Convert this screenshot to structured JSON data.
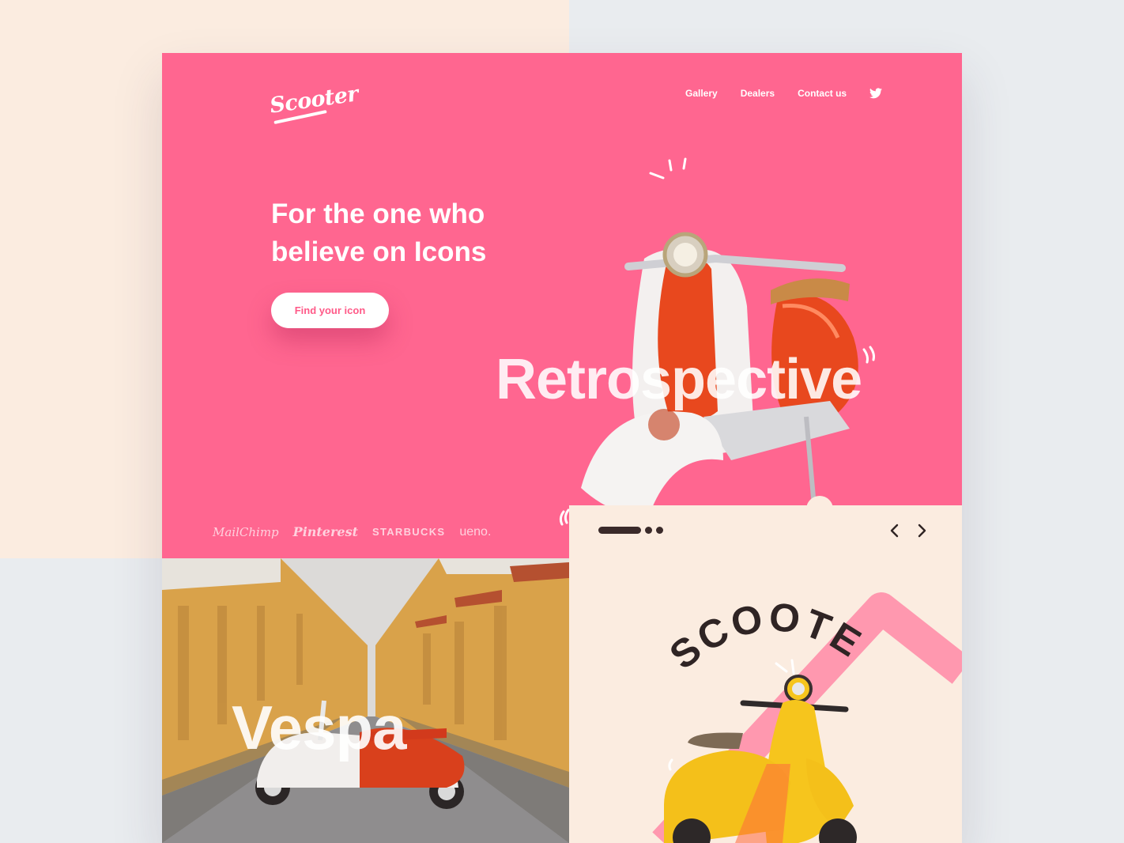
{
  "brand": {
    "logo": "Scooter"
  },
  "nav": {
    "gallery": "Gallery",
    "dealers": "Dealers",
    "contact": "Contact us",
    "twitter_icon": "twitter-icon"
  },
  "hero": {
    "headline_line1": "For the one who",
    "headline_line2": "believe on Icons",
    "cta": "Find your icon",
    "overlay_word": "Retrospective"
  },
  "brands": [
    "MailChimp",
    "Pinterest",
    "STARBUCKS",
    "ueno."
  ],
  "gallery": {
    "overlay_word": "Vespa"
  },
  "slider": {
    "title": "SCOOTER",
    "prev_icon": "chevron-left-icon",
    "next_icon": "chevron-right-icon"
  },
  "colors": {
    "accent": "#ff6690",
    "peach": "#fbece0",
    "dark": "#3a2a2a",
    "yellow": "#f6c51d",
    "orange": "#f2541d"
  }
}
